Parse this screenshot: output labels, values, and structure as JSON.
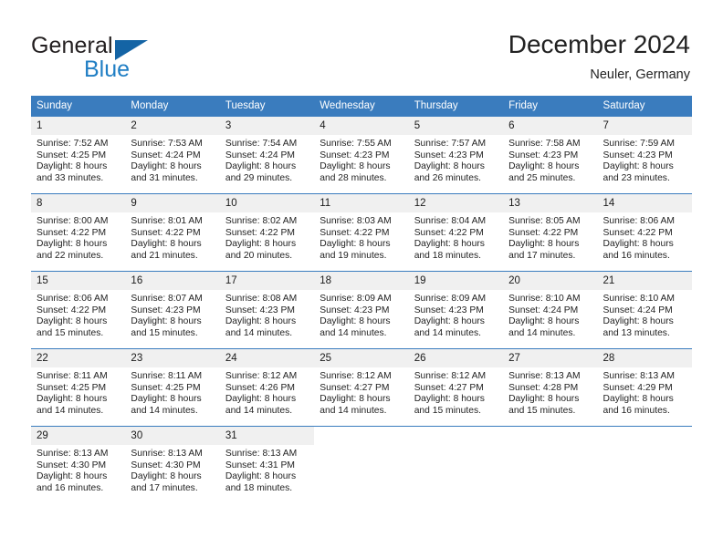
{
  "brand": {
    "name_top": "General",
    "name_bottom": "Blue",
    "accent_color": "#1f7ec4",
    "triangle_color": "#1464a5"
  },
  "header": {
    "title": "December 2024",
    "subtitle": "Neuler, Germany"
  },
  "theme": {
    "header_row_bg": "#3a7cbe",
    "header_row_text": "#ffffff",
    "daynum_bg": "#f0f0f0",
    "row_divider": "#3a7cbe",
    "body_text": "#222222"
  },
  "weekday_headers": [
    "Sunday",
    "Monday",
    "Tuesday",
    "Wednesday",
    "Thursday",
    "Friday",
    "Saturday"
  ],
  "weeks": [
    [
      {
        "day": "1",
        "sunrise": "Sunrise: 7:52 AM",
        "sunset": "Sunset: 4:25 PM",
        "daylight1": "Daylight: 8 hours",
        "daylight2": "and 33 minutes."
      },
      {
        "day": "2",
        "sunrise": "Sunrise: 7:53 AM",
        "sunset": "Sunset: 4:24 PM",
        "daylight1": "Daylight: 8 hours",
        "daylight2": "and 31 minutes."
      },
      {
        "day": "3",
        "sunrise": "Sunrise: 7:54 AM",
        "sunset": "Sunset: 4:24 PM",
        "daylight1": "Daylight: 8 hours",
        "daylight2": "and 29 minutes."
      },
      {
        "day": "4",
        "sunrise": "Sunrise: 7:55 AM",
        "sunset": "Sunset: 4:23 PM",
        "daylight1": "Daylight: 8 hours",
        "daylight2": "and 28 minutes."
      },
      {
        "day": "5",
        "sunrise": "Sunrise: 7:57 AM",
        "sunset": "Sunset: 4:23 PM",
        "daylight1": "Daylight: 8 hours",
        "daylight2": "and 26 minutes."
      },
      {
        "day": "6",
        "sunrise": "Sunrise: 7:58 AM",
        "sunset": "Sunset: 4:23 PM",
        "daylight1": "Daylight: 8 hours",
        "daylight2": "and 25 minutes."
      },
      {
        "day": "7",
        "sunrise": "Sunrise: 7:59 AM",
        "sunset": "Sunset: 4:23 PM",
        "daylight1": "Daylight: 8 hours",
        "daylight2": "and 23 minutes."
      }
    ],
    [
      {
        "day": "8",
        "sunrise": "Sunrise: 8:00 AM",
        "sunset": "Sunset: 4:22 PM",
        "daylight1": "Daylight: 8 hours",
        "daylight2": "and 22 minutes."
      },
      {
        "day": "9",
        "sunrise": "Sunrise: 8:01 AM",
        "sunset": "Sunset: 4:22 PM",
        "daylight1": "Daylight: 8 hours",
        "daylight2": "and 21 minutes."
      },
      {
        "day": "10",
        "sunrise": "Sunrise: 8:02 AM",
        "sunset": "Sunset: 4:22 PM",
        "daylight1": "Daylight: 8 hours",
        "daylight2": "and 20 minutes."
      },
      {
        "day": "11",
        "sunrise": "Sunrise: 8:03 AM",
        "sunset": "Sunset: 4:22 PM",
        "daylight1": "Daylight: 8 hours",
        "daylight2": "and 19 minutes."
      },
      {
        "day": "12",
        "sunrise": "Sunrise: 8:04 AM",
        "sunset": "Sunset: 4:22 PM",
        "daylight1": "Daylight: 8 hours",
        "daylight2": "and 18 minutes."
      },
      {
        "day": "13",
        "sunrise": "Sunrise: 8:05 AM",
        "sunset": "Sunset: 4:22 PM",
        "daylight1": "Daylight: 8 hours",
        "daylight2": "and 17 minutes."
      },
      {
        "day": "14",
        "sunrise": "Sunrise: 8:06 AM",
        "sunset": "Sunset: 4:22 PM",
        "daylight1": "Daylight: 8 hours",
        "daylight2": "and 16 minutes."
      }
    ],
    [
      {
        "day": "15",
        "sunrise": "Sunrise: 8:06 AM",
        "sunset": "Sunset: 4:22 PM",
        "daylight1": "Daylight: 8 hours",
        "daylight2": "and 15 minutes."
      },
      {
        "day": "16",
        "sunrise": "Sunrise: 8:07 AM",
        "sunset": "Sunset: 4:23 PM",
        "daylight1": "Daylight: 8 hours",
        "daylight2": "and 15 minutes."
      },
      {
        "day": "17",
        "sunrise": "Sunrise: 8:08 AM",
        "sunset": "Sunset: 4:23 PM",
        "daylight1": "Daylight: 8 hours",
        "daylight2": "and 14 minutes."
      },
      {
        "day": "18",
        "sunrise": "Sunrise: 8:09 AM",
        "sunset": "Sunset: 4:23 PM",
        "daylight1": "Daylight: 8 hours",
        "daylight2": "and 14 minutes."
      },
      {
        "day": "19",
        "sunrise": "Sunrise: 8:09 AM",
        "sunset": "Sunset: 4:23 PM",
        "daylight1": "Daylight: 8 hours",
        "daylight2": "and 14 minutes."
      },
      {
        "day": "20",
        "sunrise": "Sunrise: 8:10 AM",
        "sunset": "Sunset: 4:24 PM",
        "daylight1": "Daylight: 8 hours",
        "daylight2": "and 14 minutes."
      },
      {
        "day": "21",
        "sunrise": "Sunrise: 8:10 AM",
        "sunset": "Sunset: 4:24 PM",
        "daylight1": "Daylight: 8 hours",
        "daylight2": "and 13 minutes."
      }
    ],
    [
      {
        "day": "22",
        "sunrise": "Sunrise: 8:11 AM",
        "sunset": "Sunset: 4:25 PM",
        "daylight1": "Daylight: 8 hours",
        "daylight2": "and 14 minutes."
      },
      {
        "day": "23",
        "sunrise": "Sunrise: 8:11 AM",
        "sunset": "Sunset: 4:25 PM",
        "daylight1": "Daylight: 8 hours",
        "daylight2": "and 14 minutes."
      },
      {
        "day": "24",
        "sunrise": "Sunrise: 8:12 AM",
        "sunset": "Sunset: 4:26 PM",
        "daylight1": "Daylight: 8 hours",
        "daylight2": "and 14 minutes."
      },
      {
        "day": "25",
        "sunrise": "Sunrise: 8:12 AM",
        "sunset": "Sunset: 4:27 PM",
        "daylight1": "Daylight: 8 hours",
        "daylight2": "and 14 minutes."
      },
      {
        "day": "26",
        "sunrise": "Sunrise: 8:12 AM",
        "sunset": "Sunset: 4:27 PM",
        "daylight1": "Daylight: 8 hours",
        "daylight2": "and 15 minutes."
      },
      {
        "day": "27",
        "sunrise": "Sunrise: 8:13 AM",
        "sunset": "Sunset: 4:28 PM",
        "daylight1": "Daylight: 8 hours",
        "daylight2": "and 15 minutes."
      },
      {
        "day": "28",
        "sunrise": "Sunrise: 8:13 AM",
        "sunset": "Sunset: 4:29 PM",
        "daylight1": "Daylight: 8 hours",
        "daylight2": "and 16 minutes."
      }
    ],
    [
      {
        "day": "29",
        "sunrise": "Sunrise: 8:13 AM",
        "sunset": "Sunset: 4:30 PM",
        "daylight1": "Daylight: 8 hours",
        "daylight2": "and 16 minutes."
      },
      {
        "day": "30",
        "sunrise": "Sunrise: 8:13 AM",
        "sunset": "Sunset: 4:30 PM",
        "daylight1": "Daylight: 8 hours",
        "daylight2": "and 17 minutes."
      },
      {
        "day": "31",
        "sunrise": "Sunrise: 8:13 AM",
        "sunset": "Sunset: 4:31 PM",
        "daylight1": "Daylight: 8 hours",
        "daylight2": "and 18 minutes."
      },
      {
        "day": "",
        "sunrise": "",
        "sunset": "",
        "daylight1": "",
        "daylight2": "",
        "blank": true
      },
      {
        "day": "",
        "sunrise": "",
        "sunset": "",
        "daylight1": "",
        "daylight2": "",
        "blank": true
      },
      {
        "day": "",
        "sunrise": "",
        "sunset": "",
        "daylight1": "",
        "daylight2": "",
        "blank": true
      },
      {
        "day": "",
        "sunrise": "",
        "sunset": "",
        "daylight1": "",
        "daylight2": "",
        "blank": true
      }
    ]
  ]
}
